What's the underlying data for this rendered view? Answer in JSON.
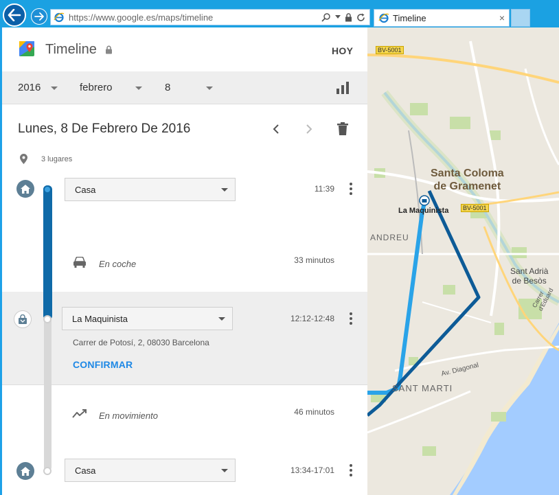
{
  "browser": {
    "url_prefix": "https://www.google.es",
    "url_path": "/maps/timeline",
    "tab_title": "Timeline",
    "tab_close": "×"
  },
  "header": {
    "title": "Timeline",
    "today_label": "HOY"
  },
  "date_selector": {
    "year": "2016",
    "month": "febrero",
    "day": "8"
  },
  "day": {
    "title": "Lunes, 8 De Febrero De 2016",
    "places_count": "3 lugares"
  },
  "timeline": [
    {
      "kind": "place",
      "name": "Casa",
      "time": "11:39",
      "icon": "home-icon"
    },
    {
      "kind": "move",
      "label": "En coche",
      "duration": "33 minutos",
      "icon": "car-icon"
    },
    {
      "kind": "place",
      "name": "La Maquinista",
      "time": "12:12-12:48",
      "address": "Carrer de Potosí, 2, 08030 Barcelona",
      "action": "CONFIRMAR",
      "icon": "shopping-bag-icon"
    },
    {
      "kind": "move",
      "label": "En movimiento",
      "duration": "46 minutos",
      "icon": "moving-icon"
    },
    {
      "kind": "place",
      "name": "Casa",
      "time": "13:34-17:01",
      "icon": "home-icon"
    }
  ],
  "map": {
    "labels": {
      "santa_coloma_1": "Santa Coloma",
      "santa_coloma_2": "de Gramenet",
      "la_maquinista": "La Maquinista",
      "road_bv5001_a": "BV-5001",
      "road_bv5001_b": "BV-5001",
      "andreu": "ANDREU",
      "sant_adria_1": "Sant Adrià",
      "sant_adria_2": "de Besòs",
      "carrer_eduard": "Carrer d'Eduard",
      "av_diagonal": "Av. Diagonal",
      "sant_marti": "SANT MARTI"
    },
    "colors": {
      "land": "#ece8df",
      "water": "#a3ccff",
      "park": "#c8dfa8",
      "route_dark": "#0d5b97",
      "route_light": "#2aa3e8",
      "road_label_bg": "#f5d64c"
    }
  }
}
